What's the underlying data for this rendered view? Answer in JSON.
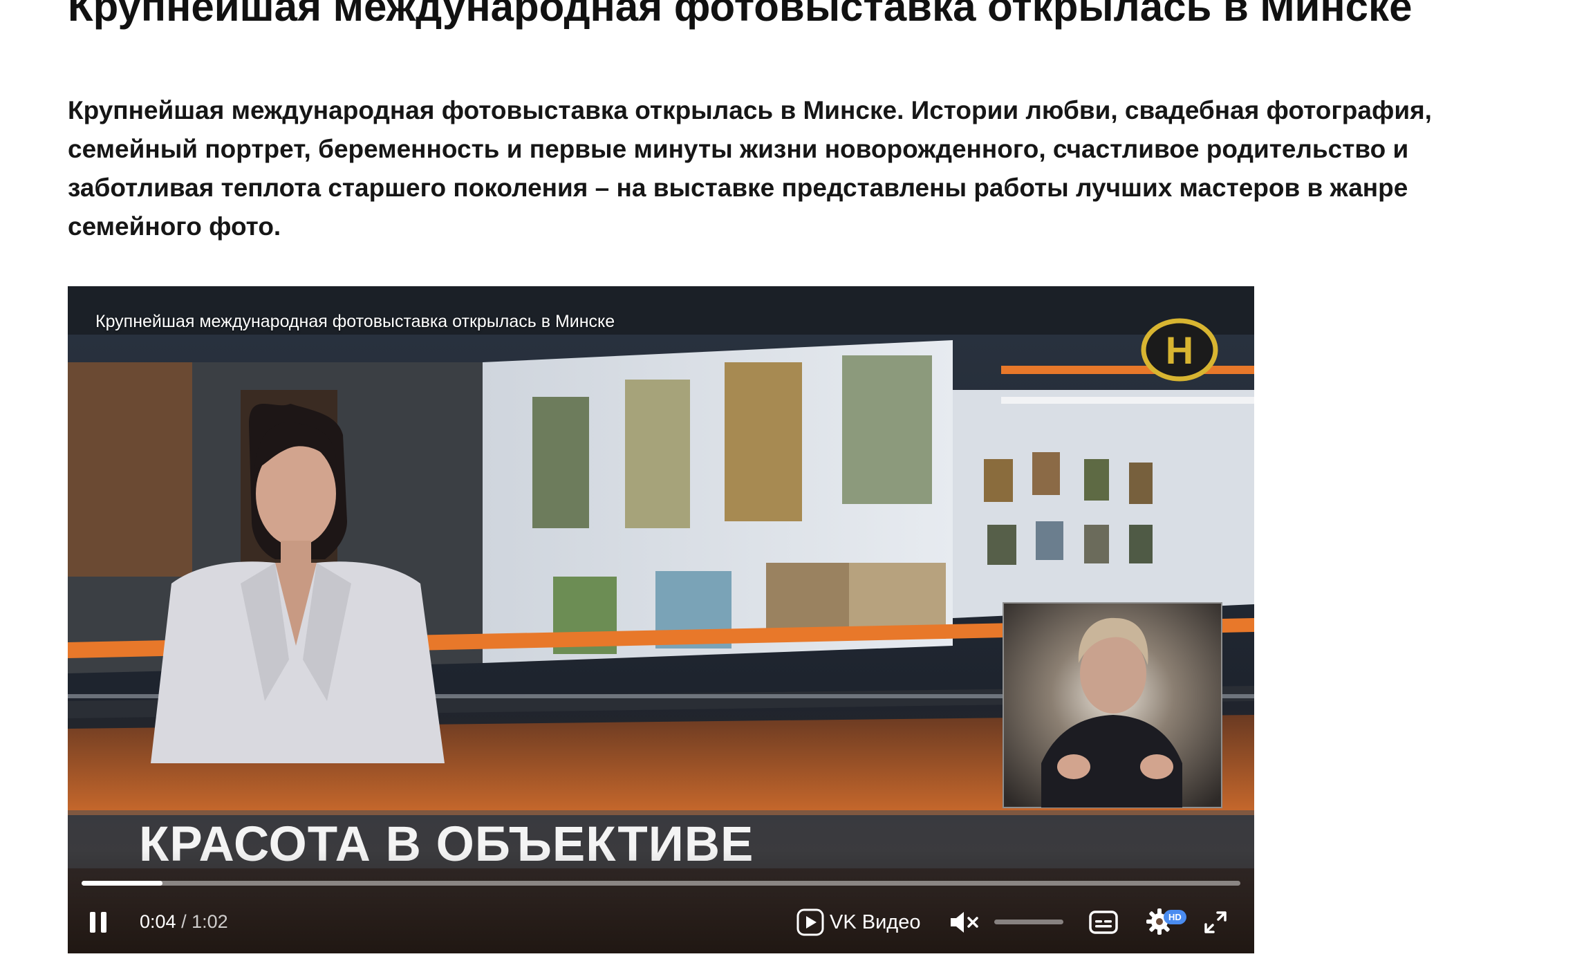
{
  "article": {
    "title": "Крупнейшая международная фотовыставка открылась в Минске",
    "lead": "Крупнейшая международная фотовыставка открылась в Минске. Истории любви, свадебная фотография, семейный портрет, беременность и первые минуты жизни новорожденного, счастливое родительство и заботливая теплота старшего поколения – на выставке представлены работы лучших мастеров в жанре семейного фото."
  },
  "player": {
    "video_title": "Крупнейшая международная фотовыставка открылась в Минске",
    "lower_third": "КРАСОТА В ОБЪЕКТИВЕ",
    "channel_logo_letter": "Н",
    "current_time": "0:04",
    "separator": " / ",
    "duration": "1:02",
    "progress_fraction": 0.07,
    "volume_fraction": 0.0,
    "muted": true,
    "brand_label": "VK Видео",
    "quality_badge": "HD",
    "icons": {
      "play_state": "pause-icon",
      "brand": "vk-video-play-icon",
      "mute": "volume-muted-icon",
      "subtitles": "subtitles-icon",
      "settings": "gear-icon",
      "fullscreen": "fullscreen-icon"
    },
    "colors": {
      "studio_accent": "#e8782a",
      "logo_gold": "#d8b531",
      "hd_badge": "#4a8cf0"
    }
  }
}
